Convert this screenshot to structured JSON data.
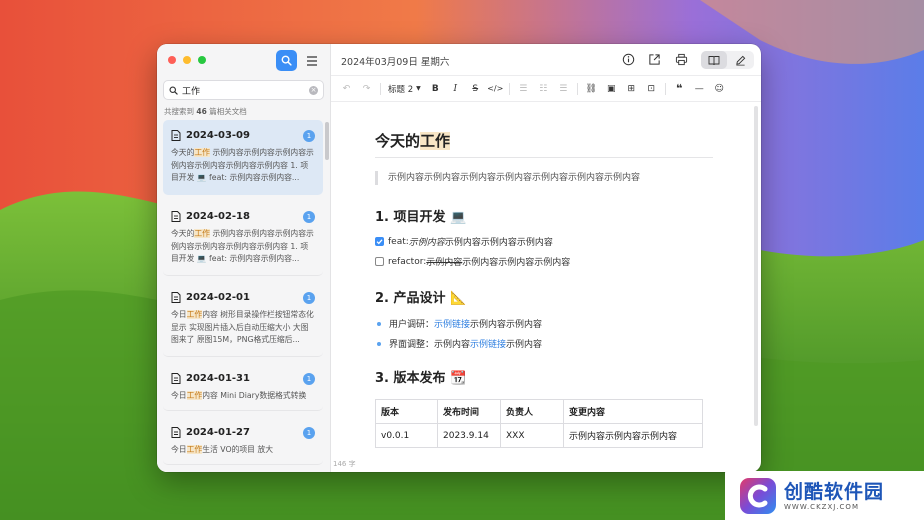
{
  "sidebar": {
    "search_value": "工作",
    "result_prefix": "共搜索到 ",
    "result_count": "46",
    "result_suffix": " 篇相关文档",
    "items": [
      {
        "date": "2024-03-09",
        "badge": "1",
        "pre": "今天的",
        "hl": "工作",
        "post": " 示例内容示例内容示例内容示例内容示例内容示例内容示例内容 1. 项目开发 💻 feat: 示例内容示例内容..."
      },
      {
        "date": "2024-02-18",
        "badge": "1",
        "pre": "今天的",
        "hl": "工作",
        "post": " 示例内容示例内容示例内容示例内容示例内容示例内容示例内容 1. 项目开发 💻 feat: 示例内容示例内容..."
      },
      {
        "date": "2024-02-01",
        "badge": "1",
        "pre": "今日",
        "hl": "工作",
        "post": "内容 树形目录操作栏按钮常态化显示 实现图片插入后自动压缩大小 大图图来了 原图15M，PNG格式压缩后..."
      },
      {
        "date": "2024-01-31",
        "badge": "1",
        "pre": "今日",
        "hl": "工作",
        "post": "内容 Mini Diary数据格式转换"
      },
      {
        "date": "2024-01-27",
        "badge": "1",
        "pre": "今日",
        "hl": "工作",
        "post": "生活 VO的项目 放大"
      }
    ]
  },
  "header": {
    "date": "2024年03月09日 星期六"
  },
  "toolbar": {
    "heading_label": "标题 2"
  },
  "editor": {
    "title_pre": "今天的",
    "title_hl": "工作",
    "quote": "示例内容示例内容示例内容示例内容示例内容示例内容示例内容",
    "h2_1": "1. 项目开发 💻",
    "task1_prefix": "feat: ",
    "task1_italic": "示例内容",
    "task1_rest": "示例内容示例内容示例内容",
    "task2_prefix": "refactor: ",
    "task2_strike": "示例内容",
    "task2_rest": "示例内容示例内容示例内容",
    "h2_2": "2. 产品设计 📐",
    "bullet1_pre": "用户调研：",
    "bullet1_link": "示例链接",
    "bullet1_post": "示例内容示例内容",
    "bullet2_pre": "界面调整：示例内容",
    "bullet2_link": "示例链接",
    "bullet2_post": "示例内容",
    "h2_3": "3. 版本发布 📆",
    "table": {
      "headers": [
        "版本",
        "发布时间",
        "负责人",
        "变更内容"
      ],
      "row": [
        "v0.0.1",
        "2023.9.14",
        "XXX",
        "示例内容示例内容示例内容"
      ]
    },
    "word_count": "146 字"
  },
  "watermark": {
    "title": "创酷软件园",
    "url": "WWW.CKZXJ.COM"
  },
  "colors": {
    "accent": "#3a8ef6",
    "highlight": "#f6e6c8",
    "link": "#2f7fe0"
  }
}
